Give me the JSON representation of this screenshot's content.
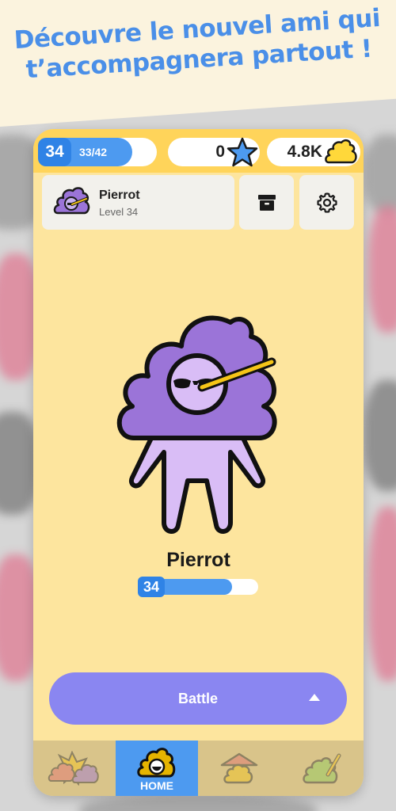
{
  "headline": {
    "line1": "Découvre le nouvel ami qui",
    "line2": "t’accompagnera partout !"
  },
  "stats": {
    "level": "34",
    "xp": "33/42",
    "xp_progress": 0.79,
    "stars": "0",
    "coins": "4.8K"
  },
  "profile": {
    "name": "Pierrot",
    "level_label": "Level 34"
  },
  "character": {
    "name": "Pierrot",
    "level": "34",
    "progress": 0.78
  },
  "battle": {
    "label": "Battle"
  },
  "nav": {
    "items": [
      {
        "icon": "battle-icon",
        "label": ""
      },
      {
        "icon": "home-icon",
        "label": "HOME"
      },
      {
        "icon": "house-icon",
        "label": ""
      },
      {
        "icon": "paint-icon",
        "label": ""
      }
    ]
  },
  "colors": {
    "accent": "#4d9af0",
    "headline": "#4a8fe8",
    "battle": "#8a86f1",
    "screen_bg": "#fde59e",
    "character": "#9b74d8"
  }
}
